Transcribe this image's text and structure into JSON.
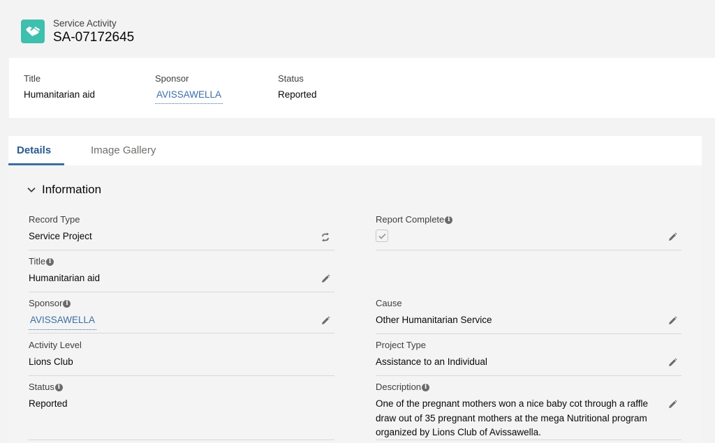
{
  "header": {
    "object_label": "Service Activity",
    "record_name": "SA-07172645",
    "icon": "handshake-icon",
    "icon_color": "#3fbfad"
  },
  "highlights": {
    "title": {
      "label": "Title",
      "value": "Humanitarian aid"
    },
    "sponsor": {
      "label": "Sponsor",
      "value": "AVISSAWELLA"
    },
    "status": {
      "label": "Status",
      "value": "Reported"
    }
  },
  "tabs": [
    {
      "label": "Details",
      "active": true
    },
    {
      "label": "Image Gallery",
      "active": false
    }
  ],
  "section": {
    "title": "Information",
    "expanded": true
  },
  "fields": {
    "record_type": {
      "label": "Record Type",
      "value": "Service Project",
      "icon": "change-record-type-icon"
    },
    "report_complete": {
      "label": "Report Complete",
      "checked": true,
      "icon": "edit-pencil-icon"
    },
    "title": {
      "label": "Title",
      "value": "Humanitarian aid",
      "icon": "edit-pencil-icon"
    },
    "sponsor": {
      "label": "Sponsor",
      "value": "AVISSAWELLA",
      "icon": "edit-pencil-icon"
    },
    "cause": {
      "label": "Cause",
      "value": "Other Humanitarian Service",
      "icon": "edit-pencil-icon"
    },
    "activity_level": {
      "label": "Activity Level",
      "value": "Lions Club"
    },
    "project_type": {
      "label": "Project Type",
      "value": "Assistance to an Individual",
      "icon": "edit-pencil-icon"
    },
    "status": {
      "label": "Status",
      "value": "Reported"
    },
    "description": {
      "label": "Description",
      "value": "One of the pregnant mothers won a nice baby cot through a raffle draw out of 35 pregnant mothers at the mega Nutritional program organized by Lions Club of Avissawella.",
      "icon": "edit-pencil-icon"
    }
  },
  "colors": {
    "link": "#3a6ea5",
    "active_tab": "#285a8e",
    "page_bg": "#f3f3f3"
  }
}
